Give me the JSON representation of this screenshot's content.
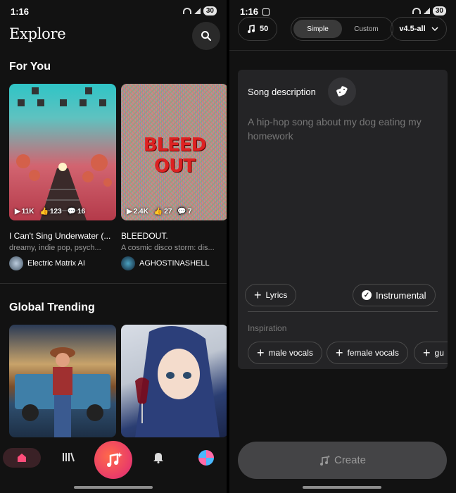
{
  "left": {
    "status": {
      "time": "1:16",
      "battery": "30"
    },
    "title": "Explore",
    "for_you": {
      "heading": "For You",
      "cards": [
        {
          "title": "I Can't Sing Underwater (...",
          "subtitle": "dreamy, indie pop, psych...",
          "author": "Electric Matrix AI",
          "plays": "11K",
          "likes": "123",
          "comments": "16"
        },
        {
          "title": "BLEEDOUT.",
          "subtitle": "A cosmic disco storm: dis...",
          "author": "AGHOSTINASHELL",
          "plays": "2.4K",
          "likes": "27",
          "comments": "7",
          "cover_text": "BLEED OUT"
        }
      ]
    },
    "global_trending": {
      "heading": "Global Trending"
    },
    "nav": {
      "items": [
        "home-icon",
        "library-icon",
        "create-icon",
        "bell-icon",
        "profile-avatar"
      ]
    }
  },
  "right": {
    "status": {
      "time": "1:16",
      "battery": "30"
    },
    "credits": "50",
    "mode": {
      "simple": "Simple",
      "custom": "Custom"
    },
    "version": "v4.5-all",
    "song": {
      "label": "Song description",
      "placeholder": "A hip-hop song about my dog eating my homework"
    },
    "lyrics_label": "Lyrics",
    "instrumental_label": "Instrumental",
    "inspiration": {
      "label": "Inspiration",
      "tags": [
        "male vocals",
        "female vocals",
        "gu"
      ]
    },
    "create_label": "Create"
  },
  "colors": {
    "accent": "#e8456a",
    "background": "#121212",
    "card": "#242426"
  }
}
